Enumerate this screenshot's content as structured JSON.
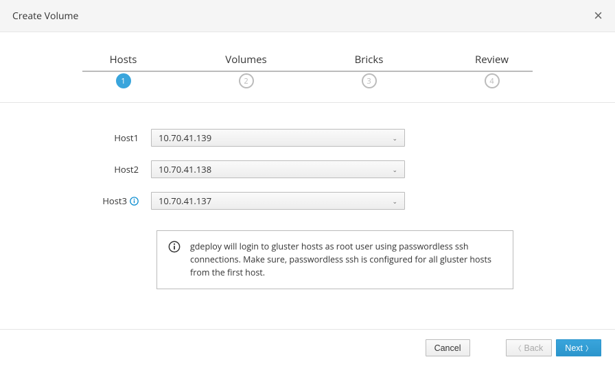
{
  "header": {
    "title": "Create Volume"
  },
  "steps": [
    {
      "label": "Hosts",
      "num": "1",
      "active": true
    },
    {
      "label": "Volumes",
      "num": "2",
      "active": false
    },
    {
      "label": "Bricks",
      "num": "3",
      "active": false
    },
    {
      "label": "Review",
      "num": "4",
      "active": false
    }
  ],
  "hosts": [
    {
      "label": "Host1",
      "value": "10.70.41.139",
      "info": false
    },
    {
      "label": "Host2",
      "value": "10.70.41.138",
      "info": false
    },
    {
      "label": "Host3",
      "value": "10.70.41.137",
      "info": true
    }
  ],
  "alert": {
    "text": "gdeploy will login to gluster hosts as root user using passwordless ssh connections. Make sure, passwordless ssh is configured for all gluster hosts from the first host."
  },
  "footer": {
    "cancel": "Cancel",
    "back": "Back",
    "next": "Next"
  }
}
